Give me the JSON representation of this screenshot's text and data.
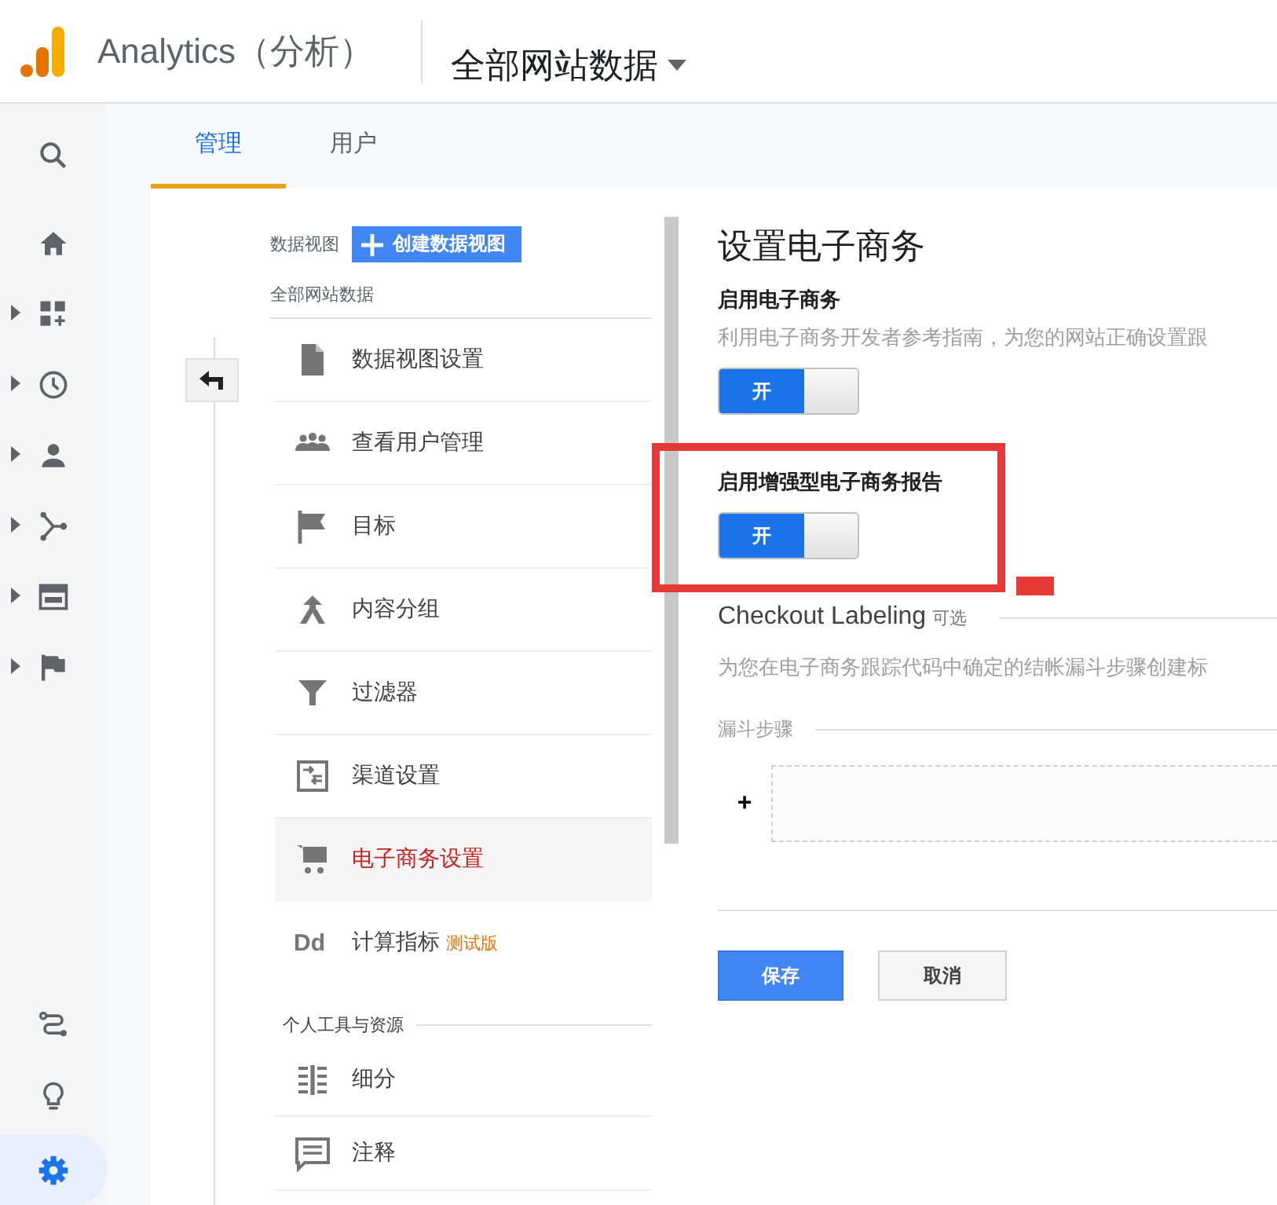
{
  "header": {
    "app_title": "Analytics（分析）",
    "property": "全部网站数据"
  },
  "rail": {
    "top": [
      {
        "kind": "search"
      },
      {
        "kind": "home"
      },
      {
        "kind": "customization",
        "expanded": false
      },
      {
        "kind": "realtime",
        "expanded": false
      },
      {
        "kind": "audience",
        "expanded": false
      },
      {
        "kind": "acquisition",
        "expanded": false
      },
      {
        "kind": "behavior",
        "expanded": false
      },
      {
        "kind": "conversions",
        "expanded": false
      }
    ],
    "bottom": [
      {
        "kind": "attribution",
        "selected": false
      },
      {
        "kind": "discover",
        "selected": false
      },
      {
        "kind": "admin",
        "selected": true
      }
    ]
  },
  "tabs": [
    {
      "label": "管理",
      "selected": true
    },
    {
      "label": "用户",
      "selected": false
    }
  ],
  "view_column": {
    "label": "数据视图",
    "create_button": "创建数据视图",
    "current_view": "全部网站数据",
    "items": [
      {
        "kind": "document",
        "label": "数据视图设置",
        "selected": false
      },
      {
        "kind": "people",
        "label": "查看用户管理",
        "selected": false
      },
      {
        "kind": "flag",
        "label": "目标",
        "selected": false
      },
      {
        "kind": "content",
        "label": "内容分组",
        "selected": false
      },
      {
        "kind": "filter",
        "label": "过滤器",
        "selected": false
      },
      {
        "kind": "channel",
        "label": "渠道设置",
        "selected": false
      },
      {
        "kind": "cart",
        "label": "电子商务设置",
        "selected": true
      },
      {
        "kind": "text",
        "icon_text": "Dd",
        "label": "计算指标",
        "badge": "测试版",
        "selected": false
      }
    ],
    "section_heading": "个人工具与资源",
    "personal_items": [
      {
        "kind": "segments",
        "label": "细分",
        "selected": false
      },
      {
        "kind": "annotation",
        "label": "注释",
        "selected": false
      }
    ]
  },
  "form": {
    "title": "设置电子商务",
    "ecommerce": {
      "label": "启用电子商务",
      "description": "利用电子商务开发者参考指南，为您的网站正确设置跟",
      "toggle": {
        "on": true,
        "label": "开"
      }
    },
    "enhanced": {
      "label": "启用增强型电子商务报告",
      "toggle": {
        "on": true,
        "label": "开"
      }
    },
    "checkout": {
      "title": "Checkout Labeling",
      "optional": "可选",
      "description": "为您在电子商务跟踪代码中确定的结帐漏斗步骤创建标",
      "funnel_label": "漏斗步骤",
      "add": "+"
    },
    "buttons": {
      "save": "保存",
      "cancel": "取消"
    }
  }
}
